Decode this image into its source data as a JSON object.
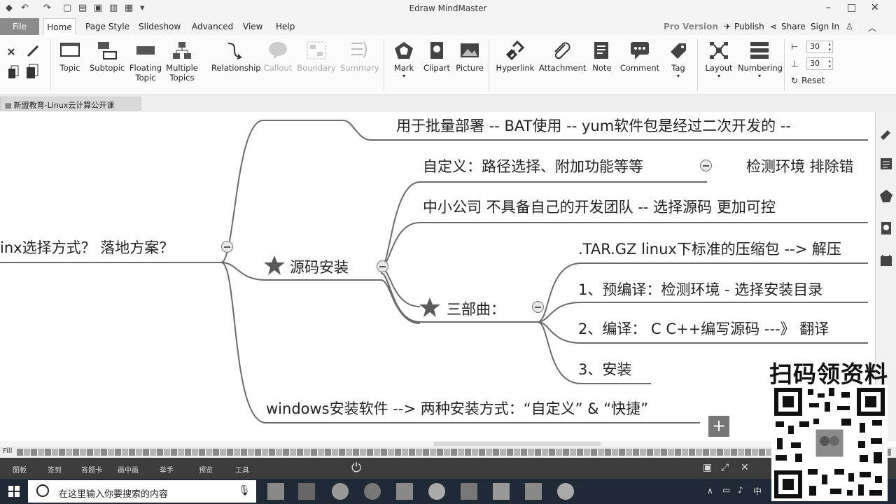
{
  "app": {
    "title": "Edraw MindMaster"
  },
  "menu": {
    "file": "File",
    "tabs": [
      "Home",
      "Page Style",
      "Slideshow",
      "Advanced",
      "View",
      "Help"
    ],
    "right": {
      "pro_version": "Pro Version",
      "publish": "Publish",
      "share": "Share",
      "sign_in": "Sign In"
    }
  },
  "ribbon": {
    "topic": "Topic",
    "subtopic": "Subtopic",
    "floating_topic": "Floating Topic",
    "multiple_topics": "Multiple Topics",
    "relationship": "Relationship",
    "callout": "Callout",
    "boundary": "Boundary",
    "summary": "Summary",
    "mark": "Mark",
    "clipart": "Clipart",
    "picture": "Picture",
    "hyperlink": "Hyperlink",
    "attachment": "Attachment",
    "note": "Note",
    "comment": "Comment",
    "tag": "Tag",
    "layout": "Layout",
    "numbering": "Numbering",
    "width_value": "30",
    "height_value": "30",
    "reset": "Reset"
  },
  "doc_tab": {
    "name": "新盟教育-Linux云计算公开课"
  },
  "mindmap": {
    "root_topic": "inx选择方式？ 落地方案？",
    "batch_note": "用于批量部署 -- BAT使用 -- yum软件包是经过二次开发的 --",
    "source_install": "源码安装",
    "custom_topic": "自定义：路径选择、附加功能等等",
    "detect_env": "检测环境 排除错",
    "small_company": "中小公司  不具备自己的开发团队 -- 选择源码 更加可控",
    "tar_gz": ".TAR.GZ linux下标准的压缩包 --> 解压",
    "three_steps": "三部曲：",
    "step1": "1、预编译：检测环境 - 选择安装目录",
    "step2": "2、编译：  C C++编写源码 ---》 翻译",
    "step3": "3、安装",
    "windows_install": "windows安装软件 --> 两种安装方式：“自定义” & “快捷”"
  },
  "palette": {
    "label": "Fill"
  },
  "bottom_bar": {
    "items": [
      "图板",
      "签到",
      "答题卡",
      "画中画",
      "举手",
      "预览",
      "工具"
    ]
  },
  "taskbar": {
    "search_placeholder": "在这里输入你要搜索的内容"
  },
  "overlay": {
    "qr_title": "扫码领资料"
  },
  "colors": {
    "branch_line": "#6b6b6b",
    "star": "#5a5a5a",
    "file_menu_bg": "#8b8b8b",
    "taskbar_bg": "#1f2a36"
  }
}
